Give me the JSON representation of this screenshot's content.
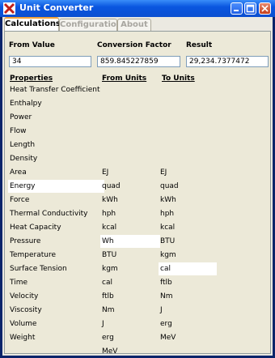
{
  "window": {
    "title": "Unit Converter"
  },
  "tabs": [
    {
      "label": "Calculations",
      "active": true
    },
    {
      "label": "Configuration",
      "active": false
    },
    {
      "label": "About",
      "active": false
    }
  ],
  "form": {
    "from_value_label": "From Value",
    "conversion_factor_label": "Conversion Factor",
    "result_label": "Result",
    "from_value": "34",
    "conversion_factor": "859.845227859",
    "result": "29,234.7377472"
  },
  "columns": {
    "properties": "Properties",
    "from_units": "From Units",
    "to_units": "To Units"
  },
  "properties": [
    "Heat Transfer Coefficient",
    "Enthalpy",
    "Power",
    "Flow",
    "Length",
    "Density",
    "Area",
    "Energy",
    "Force",
    "Thermal Conductivity",
    "Heat Capacity",
    "Pressure",
    "Temperature",
    "Surface Tension",
    "Time",
    "Velocity",
    "Viscosity",
    "Volume",
    "Weight"
  ],
  "selected_property": "Energy",
  "from_units": [
    "EJ",
    "quad",
    "kWh",
    "hph",
    "kcal",
    "Wh",
    "BTU",
    "kgm",
    "cal",
    "ftlb",
    "Nm",
    "J",
    "erg",
    "MeV"
  ],
  "selected_from_unit": "Wh",
  "to_units": [
    "EJ",
    "quad",
    "kWh",
    "hph",
    "kcal",
    "BTU",
    "kgm",
    "cal",
    "ftlb",
    "Nm",
    "J",
    "erg",
    "MeV"
  ],
  "selected_to_unit": "cal"
}
